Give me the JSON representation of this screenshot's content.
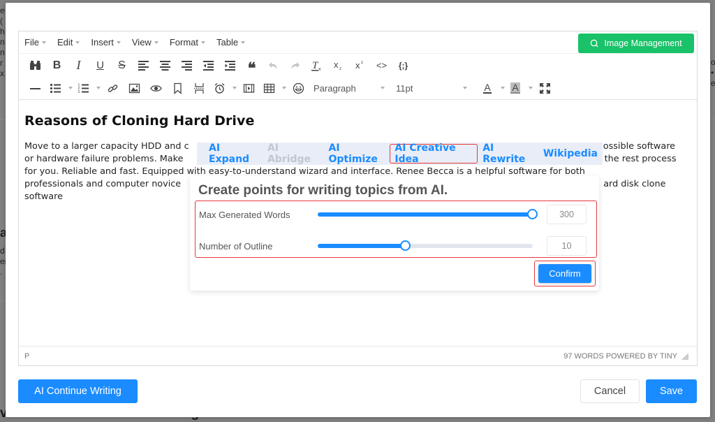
{
  "background": {
    "left_fragment_top": [
      "e",
      "(",
      "h",
      "n",
      "n",
      "r",
      "x"
    ],
    "left_fragment_mid_heading": "a",
    "left_fragment_mid_lines": [
      "d",
      "er",
      "."
    ],
    "right_fragment": [
      "o",
      "•",
      "e"
    ],
    "bottom_heading": "ve with Best Free Drive Cloning Software"
  },
  "editor": {
    "menubar": [
      {
        "label": "File"
      },
      {
        "label": "Edit"
      },
      {
        "label": "Insert"
      },
      {
        "label": "View"
      },
      {
        "label": "Format"
      },
      {
        "label": "Table"
      }
    ],
    "image_management_label": "Image Management",
    "toolbar_row1": [
      {
        "name": "find-replace",
        "icon": "binoculars-icon"
      },
      {
        "name": "bold",
        "icon": "bold-icon",
        "glyph": "B"
      },
      {
        "name": "italic",
        "icon": "italic-icon",
        "glyph": "I"
      },
      {
        "name": "underline",
        "icon": "underline-icon",
        "glyph": "U"
      },
      {
        "name": "strikethrough",
        "icon": "strikethrough-icon",
        "glyph": "S"
      },
      {
        "name": "align-left",
        "icon": "align-left-icon"
      },
      {
        "name": "align-center",
        "icon": "align-center-icon"
      },
      {
        "name": "align-right",
        "icon": "align-right-icon"
      },
      {
        "name": "outdent",
        "icon": "outdent-icon"
      },
      {
        "name": "indent",
        "icon": "indent-icon"
      },
      {
        "name": "blockquote",
        "icon": "quote-icon",
        "glyph": "❝"
      },
      {
        "name": "undo",
        "icon": "undo-icon",
        "disabled": true
      },
      {
        "name": "redo",
        "icon": "redo-icon",
        "disabled": true
      },
      {
        "name": "clear-format",
        "icon": "clear-format-icon"
      },
      {
        "name": "subscript",
        "icon": "subscript-icon"
      },
      {
        "name": "superscript",
        "icon": "superscript-icon"
      },
      {
        "name": "source-code",
        "icon": "code-icon",
        "glyph": "<>"
      },
      {
        "name": "code-sample",
        "icon": "code-sample-icon",
        "glyph": "{;}"
      }
    ],
    "toolbar_row2": {
      "block_format": "Paragraph",
      "font_size": "11pt"
    },
    "content": {
      "heading": "Reasons of Cloning Hard Drive",
      "paragraph_lines": [
        "Move to a larger capacity HDD and c",
        "possible software",
        "or hardware failure problems. Make",
        "n the rest process",
        "for you. Reliable and fast. Equipped with easy-to-understand wizard and interface. Renee Becca is a helpful software for both",
        "professionals and computer novice",
        "ard disk clone",
        "software"
      ]
    },
    "statusbar": {
      "path": "P",
      "word_count": "97 WORDS POWERED BY TINY"
    }
  },
  "ai_toolbar": {
    "items": [
      {
        "label": "AI Expand",
        "state": "enabled"
      },
      {
        "label": "AI Abridge",
        "state": "disabled"
      },
      {
        "label": "AI Optimize",
        "state": "enabled"
      },
      {
        "label": "AI Creative Idea",
        "state": "active"
      },
      {
        "label": "AI Rewrite",
        "state": "enabled"
      },
      {
        "label": "Wikipedia",
        "state": "enabled"
      }
    ]
  },
  "ai_panel": {
    "title": "Create points for writing topics from AI.",
    "fields": [
      {
        "label": "Max Generated Words",
        "value": "300",
        "fraction": 1.0
      },
      {
        "label": "Number of Outline",
        "value": "10",
        "fraction": 0.41
      }
    ],
    "confirm_label": "Confirm"
  },
  "footer": {
    "ai_continue_label": "AI Continue Writing",
    "cancel_label": "Cancel",
    "save_label": "Save"
  },
  "colors": {
    "primary": "#1a8cff",
    "success": "#19c268",
    "highlight_border": "#e5383b",
    "ai_bar_bg": "#e9edf7",
    "disabled_text": "#c1c7d0"
  }
}
